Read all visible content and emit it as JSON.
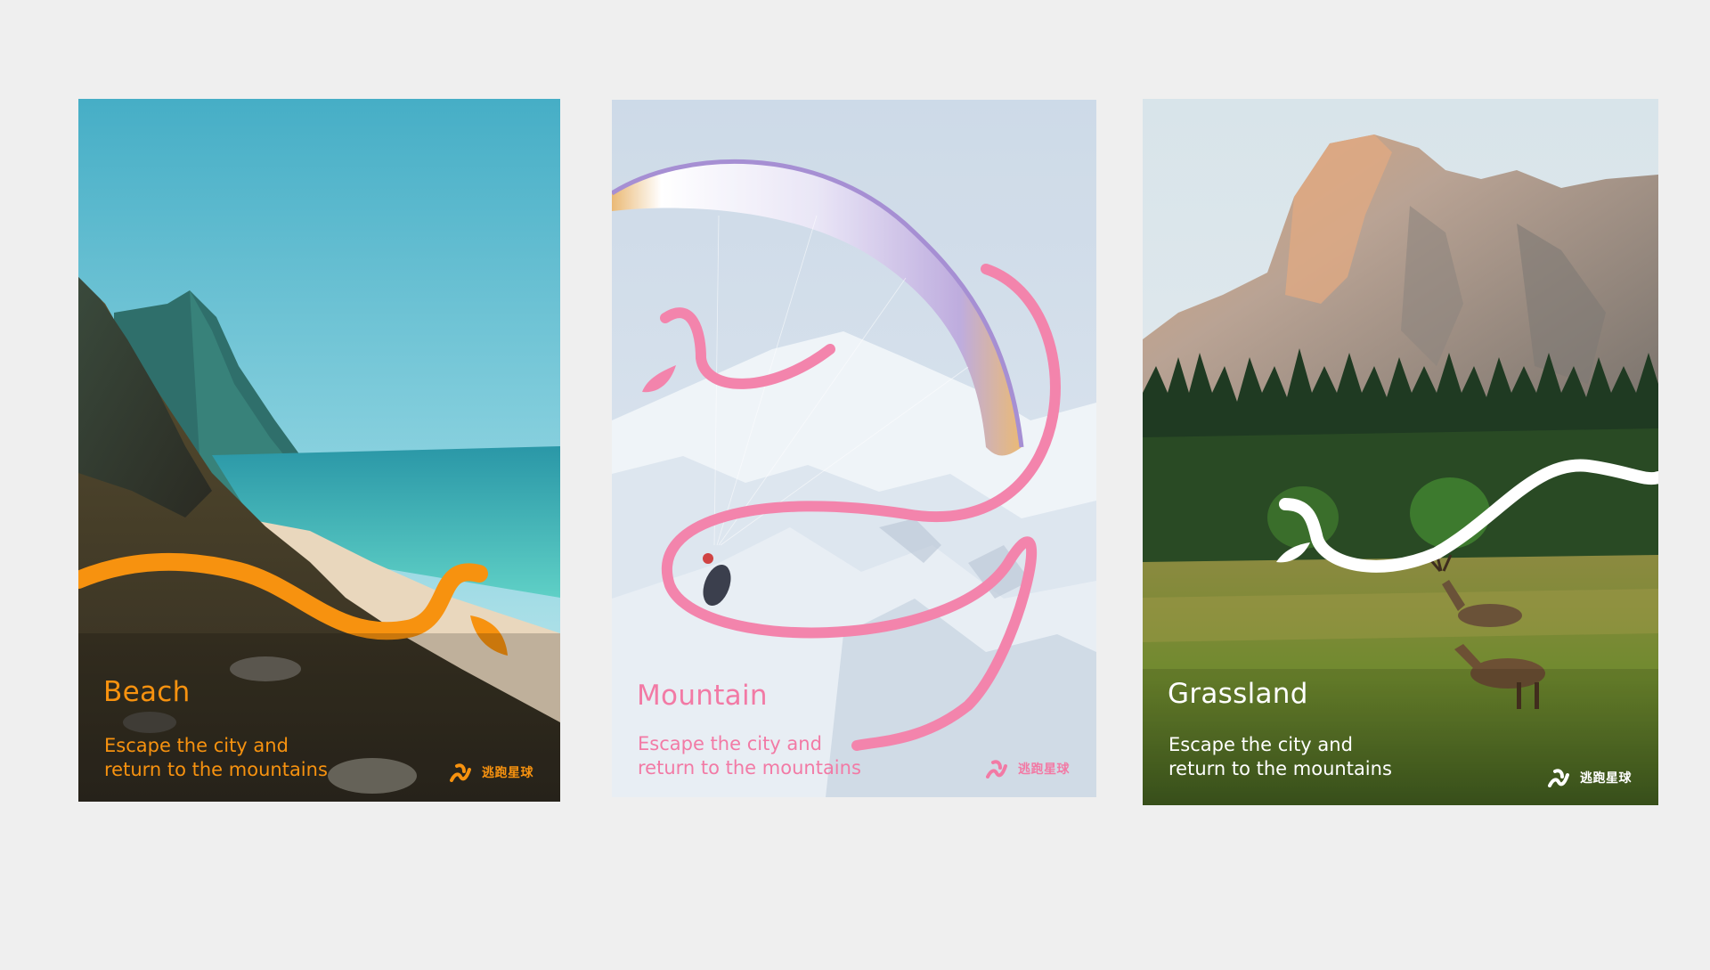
{
  "posters": [
    {
      "id": "beach",
      "title": "Beach",
      "tagline": [
        "Escape the city and",
        "return to the mountains"
      ],
      "brand_name": "逃跑星球",
      "accent_color": "#f7920f"
    },
    {
      "id": "mountain",
      "title": "Mountain",
      "tagline": [
        "Escape the city and",
        "return to the mountains"
      ],
      "brand_name": "逃跑星球",
      "accent_color": "#f27aa5"
    },
    {
      "id": "grassland",
      "title": "Grassland",
      "tagline": [
        "Escape the city and",
        "return to the mountains"
      ],
      "brand_name": "逃跑星球",
      "accent_color": "#ffffff"
    }
  ],
  "colors": {
    "page_background": "#efefef"
  },
  "icons": {
    "brand_logo": "escape-planet-logo-icon"
  }
}
